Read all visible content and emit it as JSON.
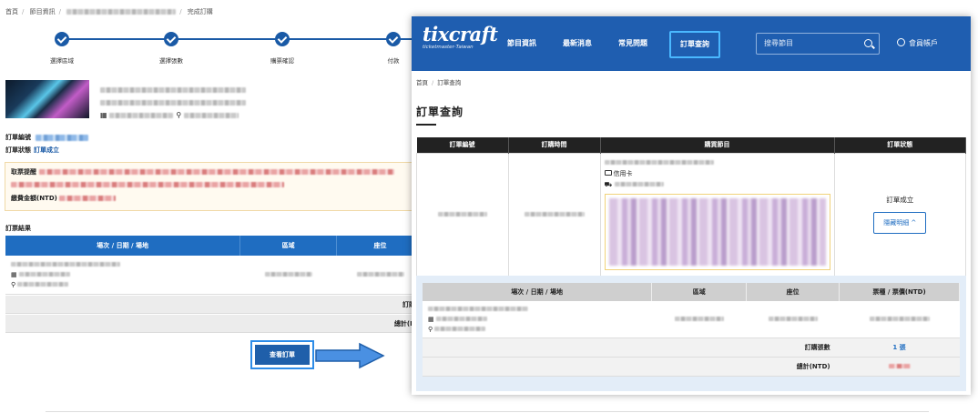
{
  "left_page": {
    "breadcrumb": [
      "首頁",
      "節目資訊",
      "完成訂購"
    ],
    "steps": [
      "選擇區域",
      "選擇張數",
      "購票確認",
      "付款"
    ],
    "order_no_label": "訂單編號",
    "order_status_label": "訂單狀態",
    "order_status_value": "訂單成立",
    "notice_label": "取票提醒",
    "amount_label": "繳費金額(NTD)",
    "result_title": "訂票結果",
    "table_headers": [
      "場次 / 日期 / 場地",
      "區域",
      "座位"
    ],
    "sum_rows": [
      "訂購",
      "總計(N"
    ],
    "view_button": "查看訂單"
  },
  "right_page": {
    "logo_word": "tixcraft",
    "logo_sub": "ticketmaster·Taiwan",
    "nav": [
      "節目資訊",
      "最新消息",
      "常見問題",
      "訂單查詢"
    ],
    "active_nav": "訂單查詢",
    "search_placeholder": "搜尋節目",
    "account_label": "會員帳戶",
    "breadcrumb": [
      "首頁",
      "訂單查詢"
    ],
    "title": "訂單查詢",
    "table_headers": [
      "訂單編號",
      "訂購時間",
      "購買節目",
      "訂單狀態"
    ],
    "payment_method": "信用卡",
    "order_status": "訂單成立",
    "hide_button": "隱藏明細 ^",
    "detail_headers": [
      "場次 / 日期 / 場地",
      "區域",
      "座位",
      "票種 / 票價(NTD)"
    ],
    "qty_label": "訂購張數",
    "qty_value": "1 張",
    "total_label": "總計(NTD)"
  },
  "colors": {
    "header_blue": "#1f5eb0",
    "accent_blue": "#1f6dc1",
    "highlight": "#4ab8ff"
  }
}
